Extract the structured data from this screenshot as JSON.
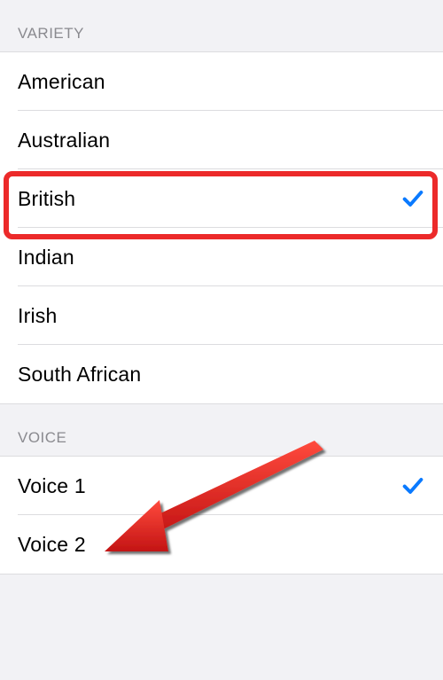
{
  "sections": {
    "variety": {
      "header": "Variety",
      "items": [
        {
          "label": "American",
          "selected": false
        },
        {
          "label": "Australian",
          "selected": false
        },
        {
          "label": "British",
          "selected": true
        },
        {
          "label": "Indian",
          "selected": false
        },
        {
          "label": "Irish",
          "selected": false
        },
        {
          "label": "South African",
          "selected": false
        }
      ],
      "selected_index": 2
    },
    "voice": {
      "header": "Voice",
      "items": [
        {
          "label": "Voice 1",
          "selected": true
        },
        {
          "label": "Voice 2",
          "selected": false
        }
      ],
      "selected_index": 0
    }
  },
  "colors": {
    "check": "#0a7aff",
    "highlight": "#ec2a2a",
    "background": "#f2f2f5"
  },
  "annotations": {
    "highlighted_variety_index": 2,
    "arrow_target": "voice.items.0"
  }
}
